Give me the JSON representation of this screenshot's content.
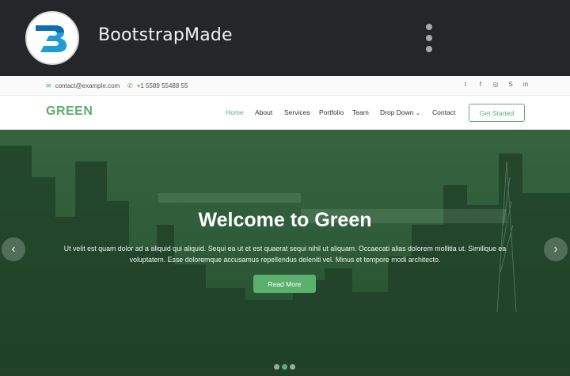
{
  "app": {
    "title": "BootstrapMade",
    "logo_icon": "bootstrapmade-logo-icon",
    "menu_icon": "kebab-menu-icon"
  },
  "site": {
    "topbar": {
      "email": "contact@example.com",
      "phone": "+1 5589 55488 55",
      "socials": [
        "twitter-icon",
        "facebook-icon",
        "instagram-icon",
        "skype-icon",
        "linkedin-icon"
      ]
    },
    "brand": "GREEN",
    "nav": [
      "Home",
      "About",
      "Services",
      "Portfolio",
      "Team",
      "Drop Down",
      "Contact"
    ],
    "cta": "Get Started",
    "hero": {
      "title": "Welcome to Green",
      "text": "Ut velit est quam dolor ad a aliquid qui aliquid. Sequi ea ut et est quaerat sequi nihil ut aliquam. Occaecati alias dolorem mollitia ut. Similique ea voluptatem. Esse doloremque accusamus repellendus deleniti vel. Minus et tempore modi architecto.",
      "button": "Read More",
      "prev_arrow": "‹",
      "next_arrow": "›",
      "slides": 3,
      "active_slide": 2
    },
    "colors": {
      "accent": "#5cae6e",
      "appbar": "#25262a",
      "hero_overlay": "#2f5b3a"
    }
  }
}
